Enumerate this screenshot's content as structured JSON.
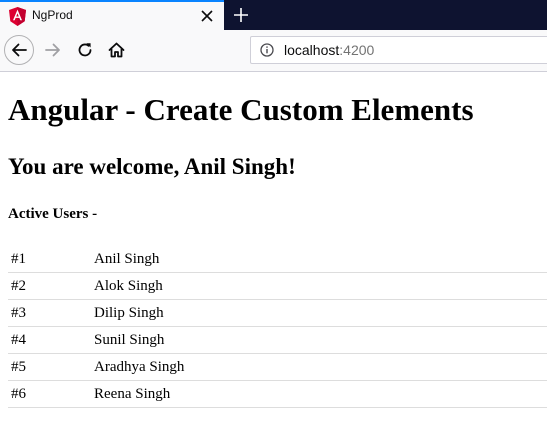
{
  "browser": {
    "tab": {
      "title": "NgProd"
    },
    "url": {
      "host": "localhost",
      "port": ":4200"
    },
    "colors": {
      "tab_strip": "#0e1330",
      "tab_accent": "#0a84ff",
      "angular_red": "#dd0031"
    },
    "icons": [
      "angular-logo-icon",
      "close-icon",
      "plus-icon",
      "arrow-left-icon",
      "arrow-right-icon",
      "reload-icon",
      "home-icon",
      "info-icon"
    ]
  },
  "page": {
    "title": "Angular - Create Custom Elements",
    "welcome": "You are welcome, Anil Singh!",
    "users_heading": "Active Users -",
    "users": [
      {
        "id": "#1",
        "name": "Anil Singh"
      },
      {
        "id": "#2",
        "name": "Alok Singh"
      },
      {
        "id": "#3",
        "name": "Dilip Singh"
      },
      {
        "id": "#4",
        "name": "Sunil Singh"
      },
      {
        "id": "#5",
        "name": "Aradhya Singh"
      },
      {
        "id": "#6",
        "name": "Reena Singh"
      }
    ]
  }
}
